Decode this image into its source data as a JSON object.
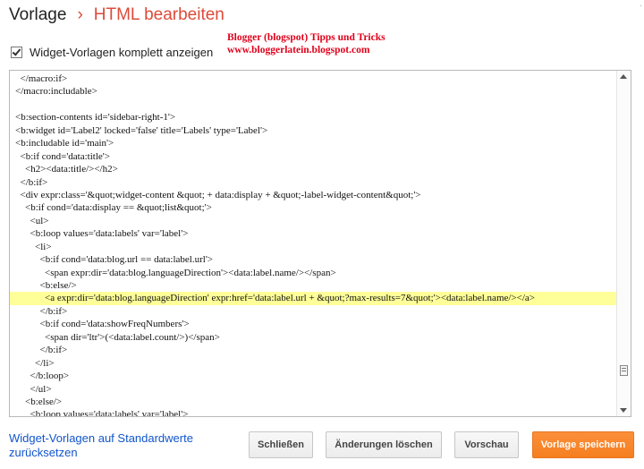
{
  "header": {
    "breadcrumb_root": "Vorlage",
    "separator": "›",
    "breadcrumb_current": "HTML bearbeiten"
  },
  "watermark": {
    "line1": "Blogger (blogspot) Tipps und Tricks",
    "line2": "www.bloggerlatein.blogspot.com"
  },
  "options": {
    "show_full_templates_label": "Widget-Vorlagen komplett anzeigen",
    "show_full_templates_checked": true
  },
  "editor": {
    "lines": [
      "  </macro:if>",
      "</macro:includable>",
      "",
      "<b:section-contents id='sidebar-right-1'>",
      "<b:widget id='Label2' locked='false' title='Labels' type='Label'>",
      "<b:includable id='main'>",
      "  <b:if cond='data:title'>",
      "    <h2><data:title/></h2>",
      "  </b:if>",
      "  <div expr:class='&quot;widget-content &quot; + data:display + &quot;-label-widget-content&quot;'>",
      "    <b:if cond='data:display == &quot;list&quot;'>",
      "      <ul>",
      "      <b:loop values='data:labels' var='label'>",
      "        <li>",
      "          <b:if cond='data:blog.url == data:label.url'>",
      "            <span expr:dir='data:blog.languageDirection'><data:label.name/></span>",
      "          <b:else/>",
      "            <a expr:dir='data:blog.languageDirection' expr:href='data:label.url + &quot;?max-results=7&quot;'><data:label.name/></a>",
      "          </b:if>",
      "          <b:if cond='data:showFreqNumbers'>",
      "            <span dir='ltr'>(<data:label.count/>)</span>",
      "          </b:if>",
      "        </li>",
      "      </b:loop>",
      "      </ul>",
      "    <b:else/>",
      "      <b:loop values='data:labels' var='label'>"
    ],
    "highlighted_line": 17
  },
  "footer": {
    "reset_link": "Widget-Vorlagen auf Standardwerte zurücksetzen",
    "close_button": "Schließen",
    "discard_button": "Änderungen löschen",
    "preview_button": "Vorschau",
    "save_button": "Vorlage speichern"
  },
  "colors": {
    "accent": "#dd4b39",
    "watermark": "#e0001a",
    "link": "#1155cc",
    "save_button": "#f57f20",
    "highlight": "#ffff99"
  }
}
